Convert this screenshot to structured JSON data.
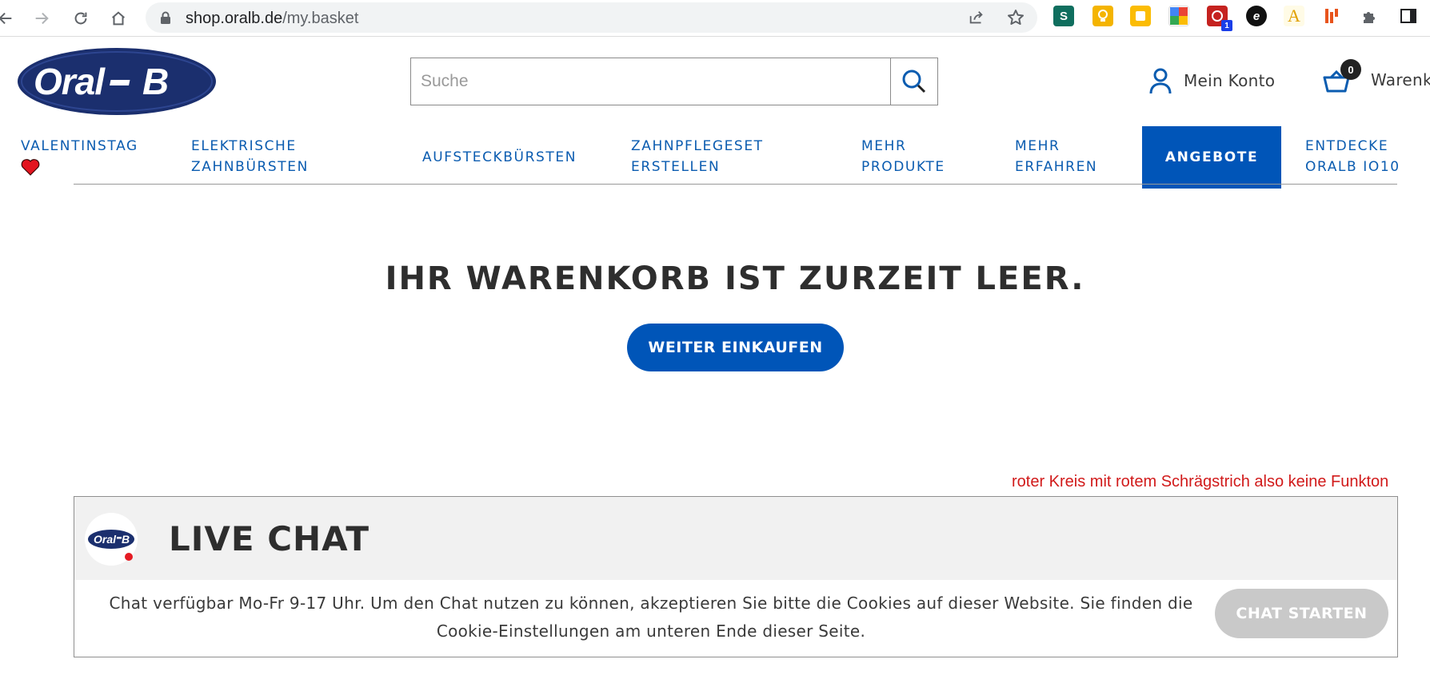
{
  "browser": {
    "url_host": "shop.oralb.de",
    "url_path": "/my.basket",
    "extension_badge": "1"
  },
  "site": {
    "brand": "Oral-B",
    "search": {
      "placeholder": "Suche"
    },
    "account_label": "Mein Konto",
    "basket": {
      "count": "0",
      "label": "Warenkorb"
    }
  },
  "nav": {
    "items": [
      {
        "line1": "VALENTINSTAG",
        "line2": ""
      },
      {
        "line1": "ELEKTRISCHE",
        "line2": "ZAHNBÜRSTEN"
      },
      {
        "line1": "AUFSTECKBÜRSTEN",
        "line2": ""
      },
      {
        "line1": "ZAHNPFLEGESET",
        "line2": "ERSTELLEN"
      },
      {
        "line1": "MEHR",
        "line2": "PRODUKTE"
      },
      {
        "line1": "MEHR",
        "line2": "ERFAHREN"
      },
      {
        "line1": "ANGEBOTE",
        "line2": ""
      },
      {
        "line1": "ENTDECKE",
        "line2": "ORALB IO10"
      }
    ]
  },
  "basket_page": {
    "empty_title": "IHR WARENKORB IST ZURZEIT LEER.",
    "continue_label": "WEITER EINKAUFEN"
  },
  "annotation": {
    "text": "roter Kreis mit rotem Schrägstrich also keine Funkton",
    "color": "#d11a1a"
  },
  "live_chat": {
    "title": "LIVE CHAT",
    "message_line1": "Chat verfügbar Mo-Fr 9-17 Uhr. Um den Chat nutzen zu können, akzeptieren Sie bitte die Cookies auf dieser Website. Sie finden die",
    "message_line2": "Cookie-Einstellungen am unteren Ende dieser Seite.",
    "button_label": "CHAT STARTEN",
    "status_dot_color": "#e51b23"
  },
  "colors": {
    "brand_blue": "#0055b8",
    "nav_text": "#0b5cb0",
    "disabled_button": "#c9c9c9"
  }
}
